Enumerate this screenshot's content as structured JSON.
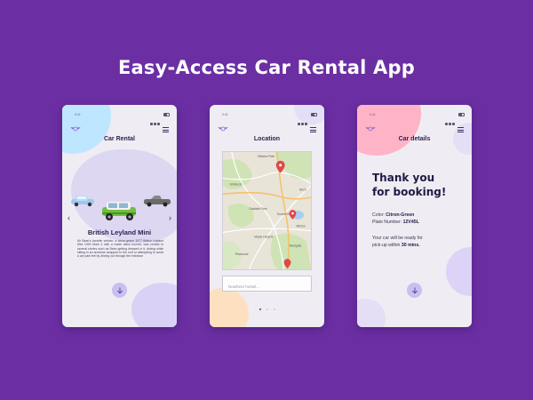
{
  "headline": "Easy-Access Car Rental App",
  "colors": {
    "background": "#6b2fa3",
    "accent": "#c9bff0",
    "pink": "#ffb3c6",
    "blue": "#bfe6ff",
    "peach": "#fde0c0",
    "screen": "#efedf3"
  },
  "screen1": {
    "title": "Car Rental",
    "car_name": "British Leyland Mini",
    "description": "Mr Bean's favorite vehicle, a citron-green 1977 British Leyland Mini 1000 Mark 4 with a matte black bonnet, was central to several stories such as Bean getting dressed in it, driving while sitting in an armchair strapped to the roof or attempting to avoid a car park fee by driving out through the entrance",
    "icons": {
      "logo": "mini-logo-icon",
      "menu": "hamburger-menu-icon",
      "prev": "chevron-left-icon",
      "next": "chevron-right-icon",
      "fab": "arrow-down-icon"
    },
    "prev_glyph": "‹",
    "next_glyph": "›"
  },
  "screen2": {
    "title": "Location",
    "search_placeholder": "Nowhere hostel...",
    "pages": 3,
    "active_page": 1,
    "icons": {
      "logo": "mini-logo-icon",
      "menu": "hamburger-menu-icon",
      "pin": "map-pin-icon"
    }
  },
  "screen3": {
    "title": "Car details",
    "thank_line1": "Thank you",
    "thank_line2": "for booking!",
    "color_label": "Color:",
    "color_value": "Citron-Green",
    "plate_label": "Plate Number:",
    "plate_value": "12V45L",
    "ready_line1": "Your car will be ready for",
    "ready_line2_prefix": "pick-up within",
    "ready_time": "30 mins.",
    "icons": {
      "logo": "mini-logo-icon",
      "menu": "hamburger-menu-icon",
      "fab": "arrow-down-icon"
    }
  }
}
